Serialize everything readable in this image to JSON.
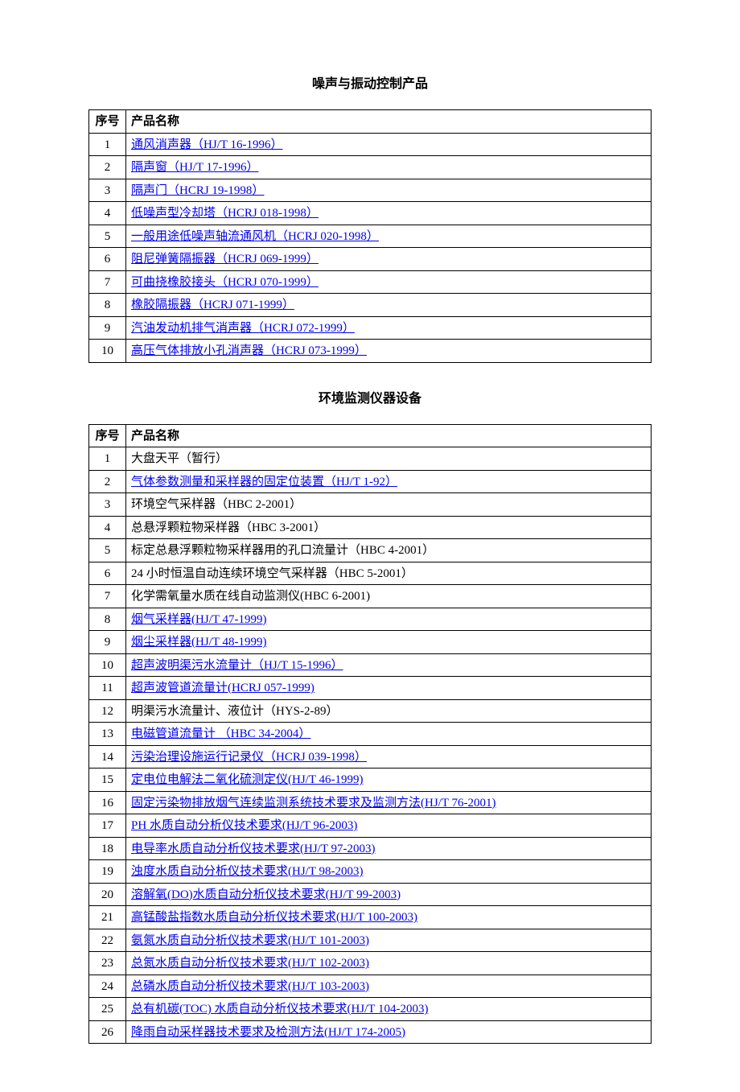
{
  "sections": [
    {
      "title": "噪声与振动控制产品",
      "headers": {
        "idx": "序号",
        "name": "产品名称"
      },
      "rows": [
        {
          "idx": "1",
          "name": "通风消声器（HJ/T 16-1996）",
          "link": true
        },
        {
          "idx": "2",
          "name": "隔声窗（HJ/T 17-1996）",
          "link": true
        },
        {
          "idx": "3",
          "name": "隔声门（HCRJ 19-1998）",
          "link": true
        },
        {
          "idx": "4",
          "name": "低噪声型冷却塔（HCRJ 018-1998）",
          "link": true
        },
        {
          "idx": "5",
          "name": "一般用途低噪声轴流通风机（HCRJ 020-1998）",
          "link": true
        },
        {
          "idx": "6",
          "name": "阻尼弹簧隔振器（HCRJ 069-1999）",
          "link": true
        },
        {
          "idx": "7",
          "name": "可曲挠橡胶接头（HCRJ 070-1999）",
          "link": true
        },
        {
          "idx": "8",
          "name": "橡胶隔振器（HCRJ 071-1999）",
          "link": true
        },
        {
          "idx": "9",
          "name": "汽油发动机排气消声器（HCRJ 072-1999）",
          "link": true
        },
        {
          "idx": "10",
          "name": "高压气体排放小孔消声器（HCRJ 073-1999）",
          "link": true
        }
      ]
    },
    {
      "title": "环境监测仪器设备",
      "headers": {
        "idx": "序号",
        "name": "产品名称"
      },
      "rows": [
        {
          "idx": "1",
          "name": "大盘天平（暂行）",
          "link": false
        },
        {
          "idx": "2",
          "name": "气体参数测量和采样器的固定位装置（HJ/T 1-92）",
          "link": true
        },
        {
          "idx": "3",
          "name": "环境空气采样器（HBC 2-2001）",
          "link": false
        },
        {
          "idx": "4",
          "name": "总悬浮颗粒物采样器（HBC 3-2001）",
          "link": false
        },
        {
          "idx": "5",
          "name": "标定总悬浮颗粒物采样器用的孔口流量计（HBC 4-2001）",
          "link": false
        },
        {
          "idx": "6",
          "name": "24 小时恒温自动连续环境空气采样器（HBC 5-2001）",
          "link": false
        },
        {
          "idx": "7",
          "name": "化学需氧量水质在线自动监测仪(HBC 6-2001)",
          "link": false
        },
        {
          "idx": "8",
          "name": "烟气采样器(HJ/T 47-1999)",
          "link": true
        },
        {
          "idx": "9",
          "name": "烟尘采样器(HJ/T 48-1999)",
          "link": true
        },
        {
          "idx": "10",
          "name": "超声波明渠污水流量计（HJ/T 15-1996）",
          "link": true
        },
        {
          "idx": "11",
          "name": "超声波管道流量计(HCRJ 057-1999)",
          "link": true
        },
        {
          "idx": "12",
          "name": "明渠污水流量计、液位计（HYS-2-89）",
          "link": false
        },
        {
          "idx": "13",
          "name": "电磁管道流量计 （HBC 34-2004）",
          "link": true
        },
        {
          "idx": "14",
          "name": "污染治理设施运行记录仪（HCRJ 039-1998）",
          "link": true
        },
        {
          "idx": "15",
          "name": "定电位电解法二氧化硫测定仪(HJ/T 46-1999)",
          "link": true
        },
        {
          "idx": "16",
          "name": "固定污染物排放烟气连续监测系统技术要求及监测方法(HJ/T 76-2001)",
          "link": true
        },
        {
          "idx": "17",
          "name": "PH 水质自动分析仪技术要求(HJ/T 96-2003)",
          "link": true
        },
        {
          "idx": "18",
          "name": "电导率水质自动分析仪技术要求(HJ/T 97-2003)",
          "link": true
        },
        {
          "idx": "19",
          "name": "浊度水质自动分析仪技术要求(HJ/T 98-2003)",
          "link": true
        },
        {
          "idx": "20",
          "name": "溶解氧(DO)水质自动分析仪技术要求(HJ/T 99-2003)",
          "link": true
        },
        {
          "idx": "21",
          "name": "高锰酸盐指数水质自动分析仪技术要求(HJ/T 100-2003)",
          "link": true
        },
        {
          "idx": "22",
          "name": "氨氮水质自动分析仪技术要求(HJ/T 101-2003)",
          "link": true
        },
        {
          "idx": "23",
          "name": "总氮水质自动分析仪技术要求(HJ/T 102-2003)",
          "link": true
        },
        {
          "idx": "24",
          "name": "总磷水质自动分析仪技术要求(HJ/T 103-2003)",
          "link": true
        },
        {
          "idx": "25",
          "name": "总有机碳(TOC) 水质自动分析仪技术要求(HJ/T 104-2003)",
          "link": true
        },
        {
          "idx": "26",
          "name": "降雨自动采样器技术要求及检测方法(HJ/T 174-2005)",
          "link": true
        }
      ]
    }
  ]
}
